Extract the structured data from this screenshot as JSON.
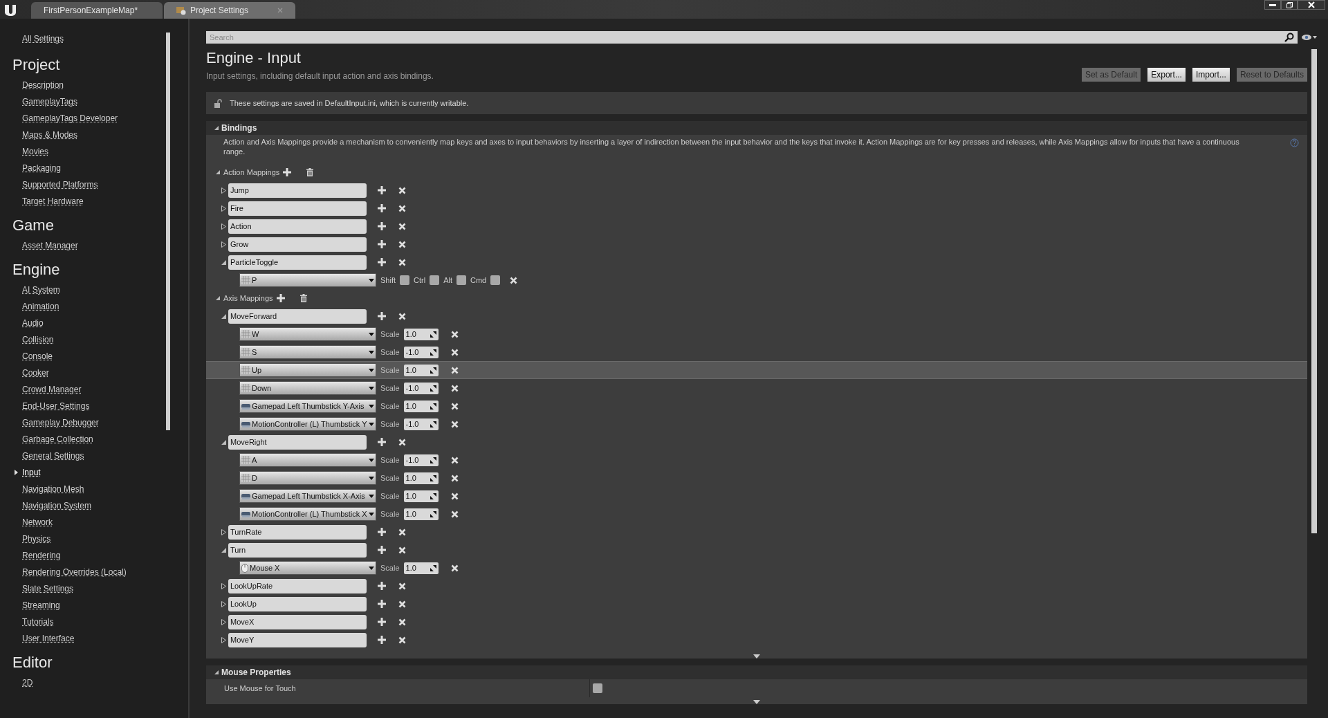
{
  "tabs": [
    {
      "label": "FirstPersonExampleMap*",
      "selected": false,
      "kind": "level"
    },
    {
      "label": "Project Settings",
      "selected": true,
      "kind": "settings"
    }
  ],
  "sidebar": {
    "all_settings": "All Settings",
    "sections": [
      {
        "title": "Project",
        "items": [
          {
            "label": "Description",
            "selected": false
          },
          {
            "label": "GameplayTags",
            "selected": false
          },
          {
            "label": "GameplayTags Developer",
            "selected": false
          },
          {
            "label": "Maps & Modes",
            "selected": false
          },
          {
            "label": "Movies",
            "selected": false
          },
          {
            "label": "Packaging",
            "selected": false
          },
          {
            "label": "Supported Platforms",
            "selected": false
          },
          {
            "label": "Target Hardware",
            "selected": false
          }
        ]
      },
      {
        "title": "Game",
        "items": [
          {
            "label": "Asset Manager",
            "selected": false
          }
        ]
      },
      {
        "title": "Engine",
        "items": [
          {
            "label": "AI System",
            "selected": false
          },
          {
            "label": "Animation",
            "selected": false
          },
          {
            "label": "Audio",
            "selected": false
          },
          {
            "label": "Collision",
            "selected": false
          },
          {
            "label": "Console",
            "selected": false
          },
          {
            "label": "Cooker",
            "selected": false
          },
          {
            "label": "Crowd Manager",
            "selected": false
          },
          {
            "label": "End-User Settings",
            "selected": false
          },
          {
            "label": "Gameplay Debugger",
            "selected": false
          },
          {
            "label": "Garbage Collection",
            "selected": false
          },
          {
            "label": "General Settings",
            "selected": false
          },
          {
            "label": "Input",
            "selected": true
          },
          {
            "label": "Navigation Mesh",
            "selected": false
          },
          {
            "label": "Navigation System",
            "selected": false
          },
          {
            "label": "Network",
            "selected": false
          },
          {
            "label": "Physics",
            "selected": false
          },
          {
            "label": "Rendering",
            "selected": false
          },
          {
            "label": "Rendering Overrides (Local)",
            "selected": false
          },
          {
            "label": "Slate Settings",
            "selected": false
          },
          {
            "label": "Streaming",
            "selected": false
          },
          {
            "label": "Tutorials",
            "selected": false
          },
          {
            "label": "User Interface",
            "selected": false
          }
        ]
      },
      {
        "title": "Editor",
        "items": [
          {
            "label": "2D",
            "selected": false
          }
        ]
      }
    ]
  },
  "search": {
    "placeholder": "Search"
  },
  "header": {
    "title": "Engine - Input",
    "description": "Input settings, including default input action and axis bindings.",
    "buttons": [
      {
        "label": "Set as Default",
        "disabled": true
      },
      {
        "label": "Export...",
        "disabled": false
      },
      {
        "label": "Import...",
        "disabled": false
      },
      {
        "label": "Reset to Defaults",
        "disabled": true
      }
    ]
  },
  "notice": "These settings are saved in DefaultInput.ini, which is currently writable.",
  "bindings": {
    "title": "Bindings",
    "description": "Action and Axis Mappings provide a mechanism to conveniently map keys and axes to input behaviors by inserting a layer of indirection between the input behavior and the keys that invoke it. Action Mappings are for key presses and releases, while Axis Mappings allow for inputs that have a continuous range.",
    "action_mappings": {
      "label": "Action Mappings",
      "items": [
        {
          "name": "Jump",
          "expanded": false
        },
        {
          "name": "Fire",
          "expanded": false
        },
        {
          "name": "Action",
          "expanded": false
        },
        {
          "name": "Grow",
          "expanded": false
        },
        {
          "name": "ParticleToggle",
          "expanded": true,
          "keys": [
            {
              "key": "P",
              "kind": "keyboard",
              "modifiers": [
                {
                  "label": "Shift",
                  "checked": false
                },
                {
                  "label": "Ctrl",
                  "checked": false
                },
                {
                  "label": "Alt",
                  "checked": false
                },
                {
                  "label": "Cmd",
                  "checked": false
                }
              ]
            }
          ]
        }
      ]
    },
    "axis_mappings": {
      "label": "Axis Mappings",
      "items": [
        {
          "name": "MoveForward",
          "expanded": true,
          "keys": [
            {
              "key": "W",
              "kind": "keyboard",
              "scale_label": "Scale",
              "scale": "1.0",
              "highlighted": false
            },
            {
              "key": "S",
              "kind": "keyboard",
              "scale_label": "Scale",
              "scale": "-1.0",
              "highlighted": false
            },
            {
              "key": "Up",
              "kind": "keyboard",
              "scale_label": "Scale",
              "scale": "1.0",
              "highlighted": true
            },
            {
              "key": "Down",
              "kind": "keyboard",
              "scale_label": "Scale",
              "scale": "-1.0",
              "highlighted": false
            },
            {
              "key": "Gamepad Left Thumbstick Y-Axis",
              "kind": "gamepad",
              "scale_label": "Scale",
              "scale": "1.0",
              "highlighted": false
            },
            {
              "key": "MotionController (L) Thumbstick Y",
              "kind": "gamepad",
              "scale_label": "Scale",
              "scale": "-1.0",
              "highlighted": false
            }
          ]
        },
        {
          "name": "MoveRight",
          "expanded": true,
          "keys": [
            {
              "key": "A",
              "kind": "keyboard",
              "scale_label": "Scale",
              "scale": "-1.0",
              "highlighted": false
            },
            {
              "key": "D",
              "kind": "keyboard",
              "scale_label": "Scale",
              "scale": "1.0",
              "highlighted": false
            },
            {
              "key": "Gamepad Left Thumbstick X-Axis",
              "kind": "gamepad",
              "scale_label": "Scale",
              "scale": "1.0",
              "highlighted": false
            },
            {
              "key": "MotionController (L) Thumbstick X",
              "kind": "gamepad",
              "scale_label": "Scale",
              "scale": "1.0",
              "highlighted": false
            }
          ]
        },
        {
          "name": "TurnRate",
          "expanded": false
        },
        {
          "name": "Turn",
          "expanded": true,
          "keys": [
            {
              "key": "Mouse X",
              "kind": "mouse",
              "scale_label": "Scale",
              "scale": "1.0",
              "highlighted": false
            }
          ]
        },
        {
          "name": "LookUpRate",
          "expanded": false
        },
        {
          "name": "LookUp",
          "expanded": false
        },
        {
          "name": "MoveX",
          "expanded": false
        },
        {
          "name": "MoveY",
          "expanded": false
        }
      ]
    }
  },
  "mouse_properties": {
    "title": "Mouse Properties",
    "rows": [
      {
        "label": "Use Mouse for Touch",
        "checked": false
      }
    ]
  }
}
